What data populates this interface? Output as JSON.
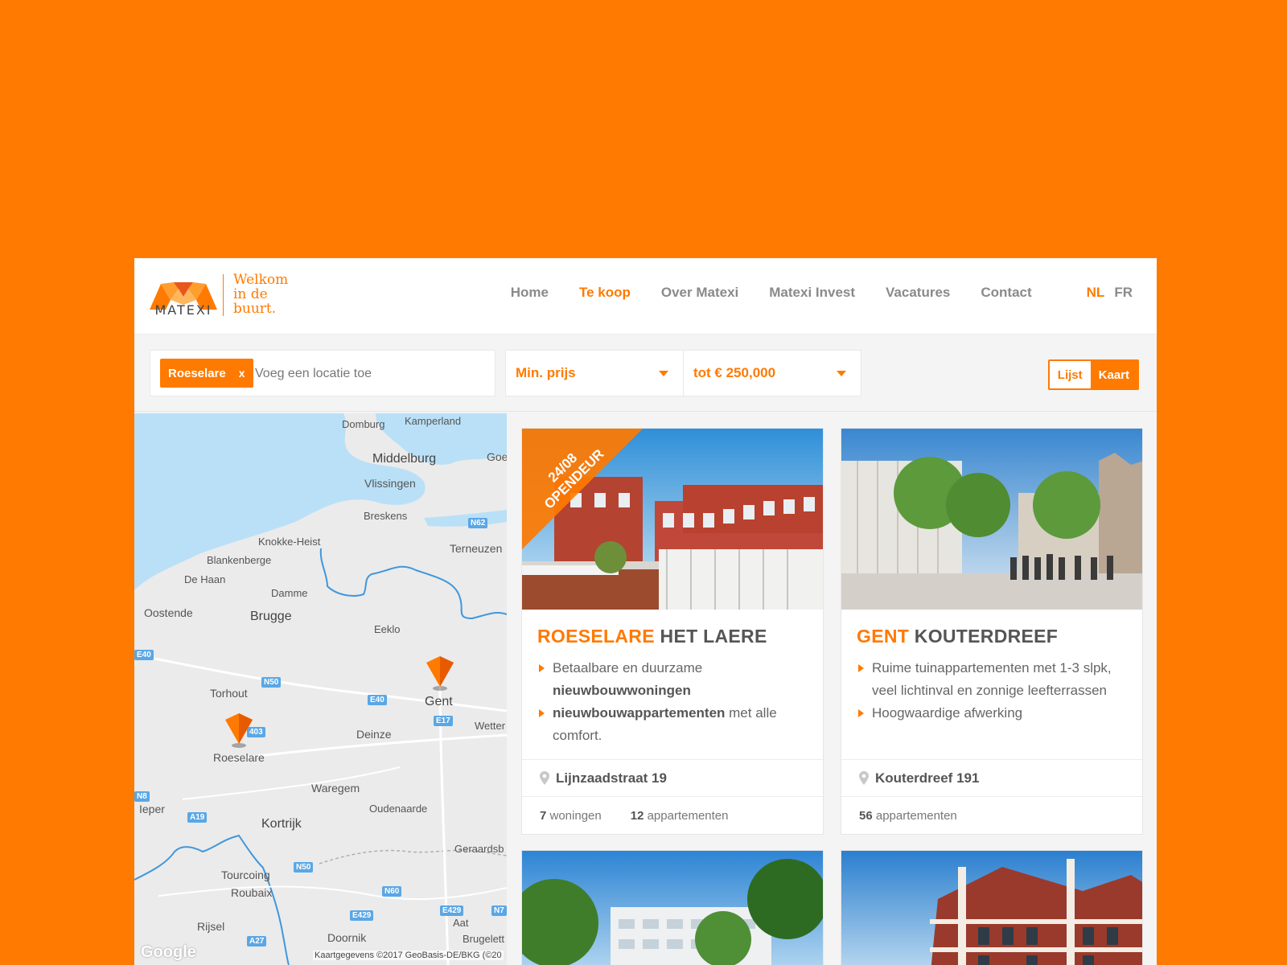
{
  "header": {
    "logo_text": "MATEXI",
    "tagline": [
      "Welkom",
      "in de",
      "buurt."
    ],
    "nav": [
      {
        "label": "Home",
        "active": false
      },
      {
        "label": "Te koop",
        "active": true
      },
      {
        "label": "Over Matexi",
        "active": false
      },
      {
        "label": "Matexi Invest",
        "active": false
      },
      {
        "label": "Vacatures",
        "active": false
      },
      {
        "label": "Contact",
        "active": false
      }
    ],
    "languages": [
      {
        "label": "NL",
        "active": true
      },
      {
        "label": "FR",
        "active": false
      }
    ]
  },
  "filters": {
    "location_chip": "Roeselare",
    "chip_remove": "x",
    "location_placeholder": "Voeg een locatie toe",
    "min_price": "Min. prijs",
    "max_price": "tot € 250,000",
    "view_list": "Lijst",
    "view_map": "Kaart"
  },
  "map": {
    "labels": [
      "Domburg",
      "Kamperland",
      "Middelburg",
      "Goe",
      "Vlissingen",
      "Breskens",
      "Knokke-Heist",
      "Terneuzen",
      "Blankenberge",
      "De Haan",
      "Damme",
      "Oostende",
      "Brugge",
      "Eeklo",
      "Torhout",
      "Gent",
      "Wetter",
      "Deinze",
      "Roeselare",
      "Waregem",
      "Oudenaarde",
      "Ieper",
      "Kortrijk",
      "Geraardsb",
      "Tourcoing",
      "Roubaix",
      "Rijsel",
      "Doornik",
      "Aat",
      "Brugelett"
    ],
    "roads": [
      "N62",
      "E40",
      "N50",
      "E40",
      "E17",
      "403",
      "A19",
      "N8",
      "N50",
      "N60",
      "E429",
      "E429",
      "N7",
      "A27"
    ],
    "google": "Google",
    "attribution": "Kaartgegevens ©2017 GeoBasis-DE/BKG (©20"
  },
  "cards": [
    {
      "badge_date": "24/08",
      "badge_text": "OPENDEUR",
      "city": "ROESELARE",
      "name": "HET LAERE",
      "bullet1_a": "Betaalbare en duurzame",
      "bullet1_b": "nieuwbouwwoningen",
      "bullet2_a": "nieuwbouwappartementen",
      "bullet2_b": " met alle comfort.",
      "address": "Lijnzaadstraat 19",
      "stat1_num": "7",
      "stat1_label": " woningen",
      "stat2_num": "12",
      "stat2_label": " appartementen"
    },
    {
      "city": "GENT",
      "name": "KOUTERDREEF",
      "bullet1": "Ruime tuinappartementen met 1-3 slpk, veel lichtinval en zonnige leefterrassen",
      "bullet2": "Hoogwaardige afwerking",
      "address": "Kouterdreef 191",
      "stat1_num": "56",
      "stat1_label": " appartementen"
    }
  ],
  "colors": {
    "accent": "#ff7a00",
    "water": "#b9e0f7",
    "land": "#ebebeb",
    "border_line": "#3f97dc"
  }
}
